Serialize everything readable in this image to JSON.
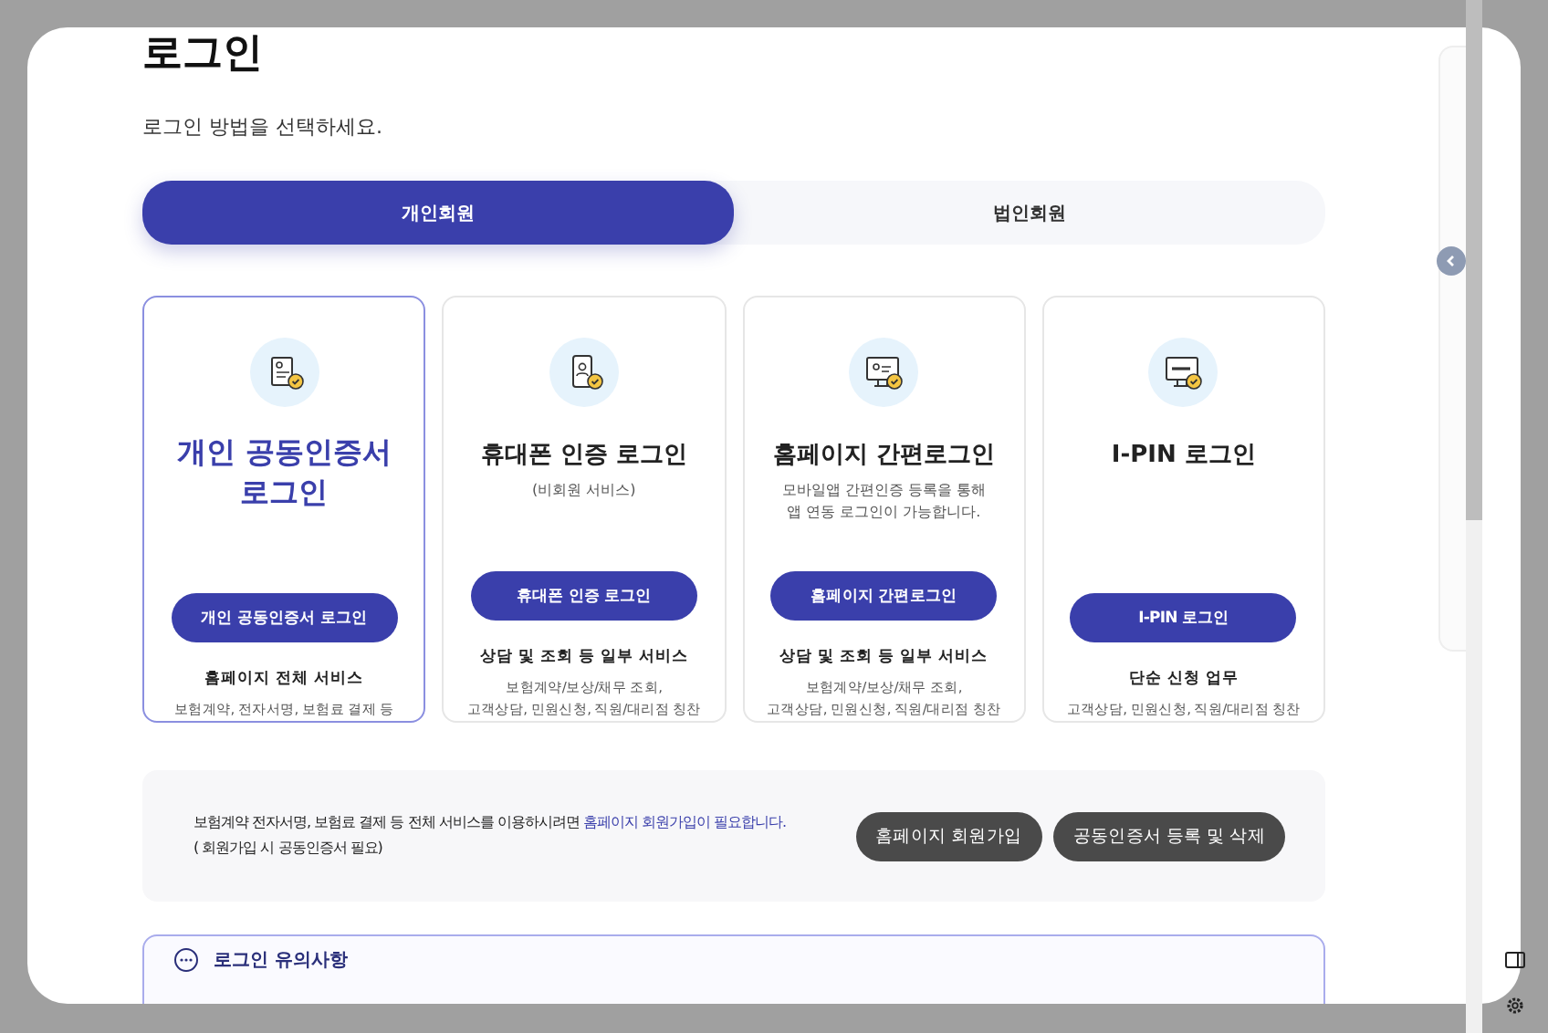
{
  "title": "로그인",
  "subtitle": "로그인 방법을 선택하세요.",
  "tabs": [
    {
      "label": "개인회원",
      "selected": true
    },
    {
      "label": "법인회원",
      "selected": false
    }
  ],
  "cards": [
    {
      "kind": "certificate",
      "selected": true,
      "title": "개인 공동인증서 로그인",
      "button": "개인 공동인증서 로그인",
      "service_title": "홈페이지 전체 서비스",
      "service_desc": "보험계약, 전자서명, 보험료 결제 등"
    },
    {
      "kind": "phone",
      "selected": false,
      "title": "휴대폰 인증 로그인",
      "note": "(비회원 서비스)",
      "button": "휴대폰 인증 로그인",
      "service_title": "상담 및 조회 등 일부 서비스",
      "service_desc": "보험계약/보상/채무 조회,\n고객상담, 민원신청, 직원/대리점 칭찬"
    },
    {
      "kind": "monitor",
      "selected": false,
      "title": "홈페이지 간편로그인",
      "note": "모바일앱 간편인증 등록을 통해\n앱 연동 로그인이 가능합니다.",
      "button": "홈페이지 간편로그인",
      "service_title": "상담 및 조회 등 일부 서비스",
      "service_desc": "보험계약/보상/채무 조회,\n고객상담, 민원신청, 직원/대리점 칭찬"
    },
    {
      "kind": "ipin",
      "selected": false,
      "title": "I-PIN 로그인",
      "button": "I-PIN 로그인",
      "service_title": "단순 신청 업무",
      "service_desc": "고객상담, 민원신청, 직원/대리점 칭찬"
    }
  ],
  "info": {
    "text": "보험계약 전자서명, 보험료 결제 등 전체 서비스를 이용하시려면 ",
    "highlight": "홈페이지 회원가입이 필요합니다.",
    "line2": "( 회원가입 시 공동인증서 필요)",
    "buttons": [
      "홈페이지 회원가입",
      "공동인증서 등록 및 삭제"
    ]
  },
  "notice": {
    "title": "로그인 유의사항"
  }
}
